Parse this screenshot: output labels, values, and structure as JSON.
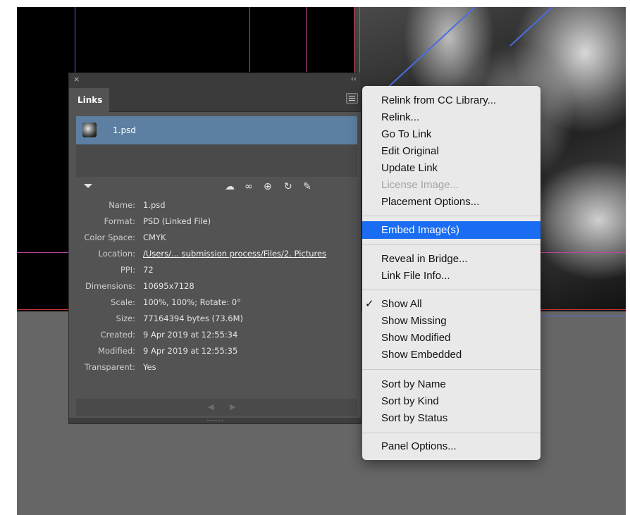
{
  "panel": {
    "close_glyph": "×",
    "collapse_glyph": "‹‹",
    "tab_label": "Links",
    "file_name": "1.psd",
    "info": [
      {
        "label": "Name:",
        "value": "1.psd"
      },
      {
        "label": "Format:",
        "value": "PSD (Linked File)"
      },
      {
        "label": "Color Space:",
        "value": "CMYK"
      },
      {
        "label": "Location:",
        "value": "/Users/... submission process/Files/2. Pictures"
      },
      {
        "label": "PPI:",
        "value": "72"
      },
      {
        "label": "Dimensions:",
        "value": "10695x7128"
      },
      {
        "label": "Scale:",
        "value": "100%, 100%; Rotate: 0°"
      },
      {
        "label": "Size:",
        "value": "77164394 bytes (73.6M)"
      },
      {
        "label": "Created:",
        "value": "9 Apr 2019 at 12:55:34"
      },
      {
        "label": "Modified:",
        "value": "9 Apr 2019 at 12:55:35"
      },
      {
        "label": "Transparent:",
        "value": "Yes"
      }
    ],
    "toolbar_icons": [
      "cloud-link-icon",
      "chain-link-icon",
      "goto-link-icon",
      "update-link-icon",
      "edit-pencil-icon"
    ]
  },
  "menu": {
    "items": [
      {
        "label": "Relink from CC Library...",
        "enabled": true
      },
      {
        "label": "Relink...",
        "enabled": true
      },
      {
        "label": "Go To Link",
        "enabled": true
      },
      {
        "label": "Edit Original",
        "enabled": true
      },
      {
        "label": "Update Link",
        "enabled": true
      },
      {
        "label": "License Image...",
        "enabled": false
      },
      {
        "label": "Placement Options...",
        "enabled": true
      },
      {
        "label": "Embed Image(s)",
        "enabled": true,
        "highlighted": true
      },
      {
        "label": "Reveal in Bridge...",
        "enabled": true
      },
      {
        "label": "Link File Info...",
        "enabled": true
      },
      {
        "label": "Show All",
        "enabled": true,
        "checked": true
      },
      {
        "label": "Show Missing",
        "enabled": true
      },
      {
        "label": "Show Modified",
        "enabled": true
      },
      {
        "label": "Show Embedded",
        "enabled": true
      },
      {
        "label": "Sort by Name",
        "enabled": true
      },
      {
        "label": "Sort by Kind",
        "enabled": true
      },
      {
        "label": "Sort by Status",
        "enabled": true
      },
      {
        "label": "Panel Options...",
        "enabled": true
      }
    ],
    "check_glyph": "✓",
    "highlight_color": "#1a6df2"
  }
}
